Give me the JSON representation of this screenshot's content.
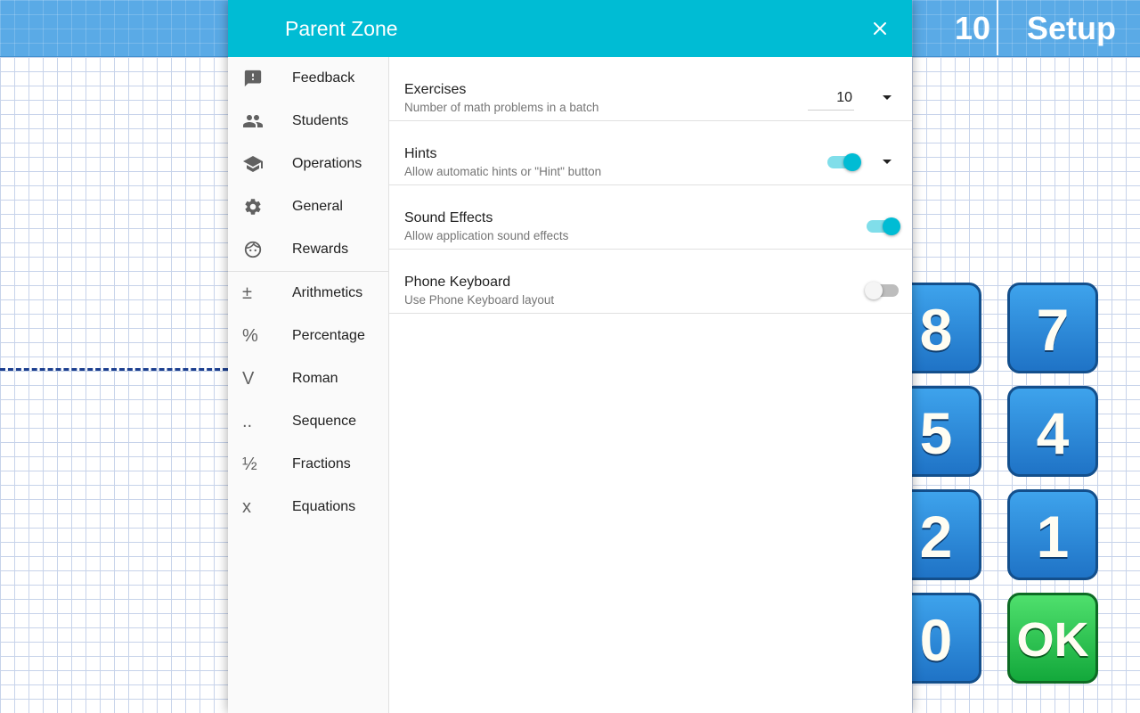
{
  "app": {
    "counter": "10",
    "setup_label": "Setup",
    "keypad": [
      "8",
      "7",
      "5",
      "4",
      "2",
      "1",
      "0",
      "OK"
    ]
  },
  "dialog": {
    "title": "Parent Zone",
    "close_icon": "close-icon",
    "nav": [
      {
        "label": "Feedback",
        "icon": "feedback-icon"
      },
      {
        "label": "Students",
        "icon": "people-icon"
      },
      {
        "label": "Operations",
        "icon": "school-icon"
      },
      {
        "label": "General",
        "icon": "gear-icon"
      },
      {
        "label": "Rewards",
        "icon": "face-icon"
      },
      {
        "label": "Arithmetics",
        "glyph": "±"
      },
      {
        "label": "Percentage",
        "glyph": "%"
      },
      {
        "label": "Roman",
        "glyph": "V"
      },
      {
        "label": "Sequence",
        "glyph": ".."
      },
      {
        "label": "Fractions",
        "glyph": "½"
      },
      {
        "label": "Equations",
        "glyph": "x"
      }
    ],
    "settings": [
      {
        "title": "Exercises",
        "subtitle": "Number of math problems in a batch",
        "value": "10"
      },
      {
        "title": "Hints",
        "subtitle": "Allow automatic hints or \"Hint\" button",
        "enabled": true
      },
      {
        "title": "Sound Effects",
        "subtitle": "Allow application sound effects",
        "enabled": true
      },
      {
        "title": "Phone Keyboard",
        "subtitle": "Use Phone Keyboard layout",
        "enabled": false
      }
    ]
  },
  "colors": {
    "accent": "#00bcd4",
    "key_blue": "#1f73c6",
    "key_green": "#13a83b"
  }
}
